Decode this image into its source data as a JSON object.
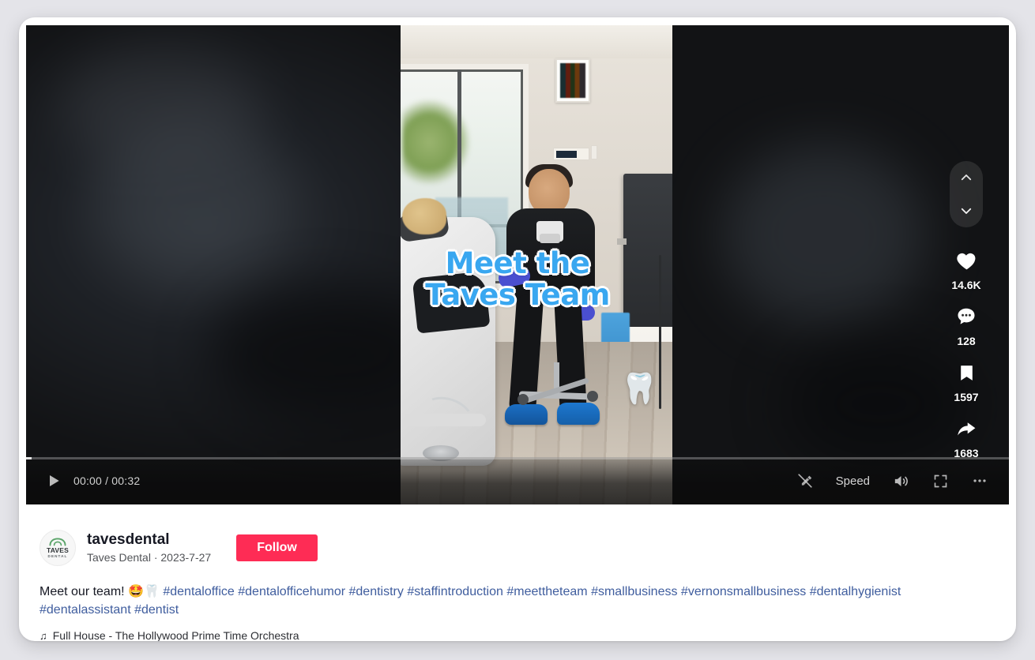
{
  "player": {
    "time_label": "00:00 / 00:32",
    "current_time": "00:00",
    "duration": "00:32",
    "progress_percent": 0.6,
    "play_icon": "play-icon",
    "controls": {
      "captions_off_label": "captions-off-icon",
      "speed_label": "Speed",
      "volume_label": "volume-icon",
      "fullscreen_label": "fullscreen-icon",
      "more_label": "more-options-icon"
    }
  },
  "video": {
    "overlay_caption_line1": "Meet the",
    "overlay_caption_line2": "Taves Team",
    "overlay_text_color": "#39a7f0",
    "overlay_outline_color": "#ffffff",
    "tooth_emoji": "🦷",
    "scene_description": "Dentist in black scrubs seated on a stool talking to a patient in a dental chair inside a dental operatory"
  },
  "navigation": {
    "prev_label": "chevron-up-icon",
    "next_label": "chevron-down-icon"
  },
  "actions": [
    {
      "name": "like",
      "icon": "heart-icon",
      "count": "14.6K"
    },
    {
      "name": "comment",
      "icon": "comment-icon",
      "count": "128"
    },
    {
      "name": "bookmark",
      "icon": "bookmark-icon",
      "count": "1597"
    },
    {
      "name": "share",
      "icon": "share-icon",
      "count": "1683"
    }
  ],
  "author": {
    "username": "tavesdental",
    "display_name": "Taves Dental",
    "separator": "·",
    "date": "2023-7-27",
    "meta_line": "Taves Dental · 2023-7-27",
    "follow_label": "Follow",
    "follow_color": "#fe2c55",
    "avatar": {
      "top_text": "TAVES",
      "bottom_text": "DENTAL",
      "arch_color": "#5aa469"
    }
  },
  "description": {
    "text_prefix": "Meet our team! 🤩🦷 ",
    "hashtags": [
      "#dentaloffice",
      "#dentalofficehumor",
      "#dentistry",
      "#staffintroduction",
      "#meettheteam",
      "#smallbusiness",
      "#vernonsmallbusiness",
      "#dentalhygienist",
      "#dentalassistant",
      "#dentist"
    ],
    "hashtag_color": "#3f5d9e"
  },
  "music": {
    "note_icon": "♫",
    "label": "Full House - The Hollywood Prime Time Orchestra"
  }
}
